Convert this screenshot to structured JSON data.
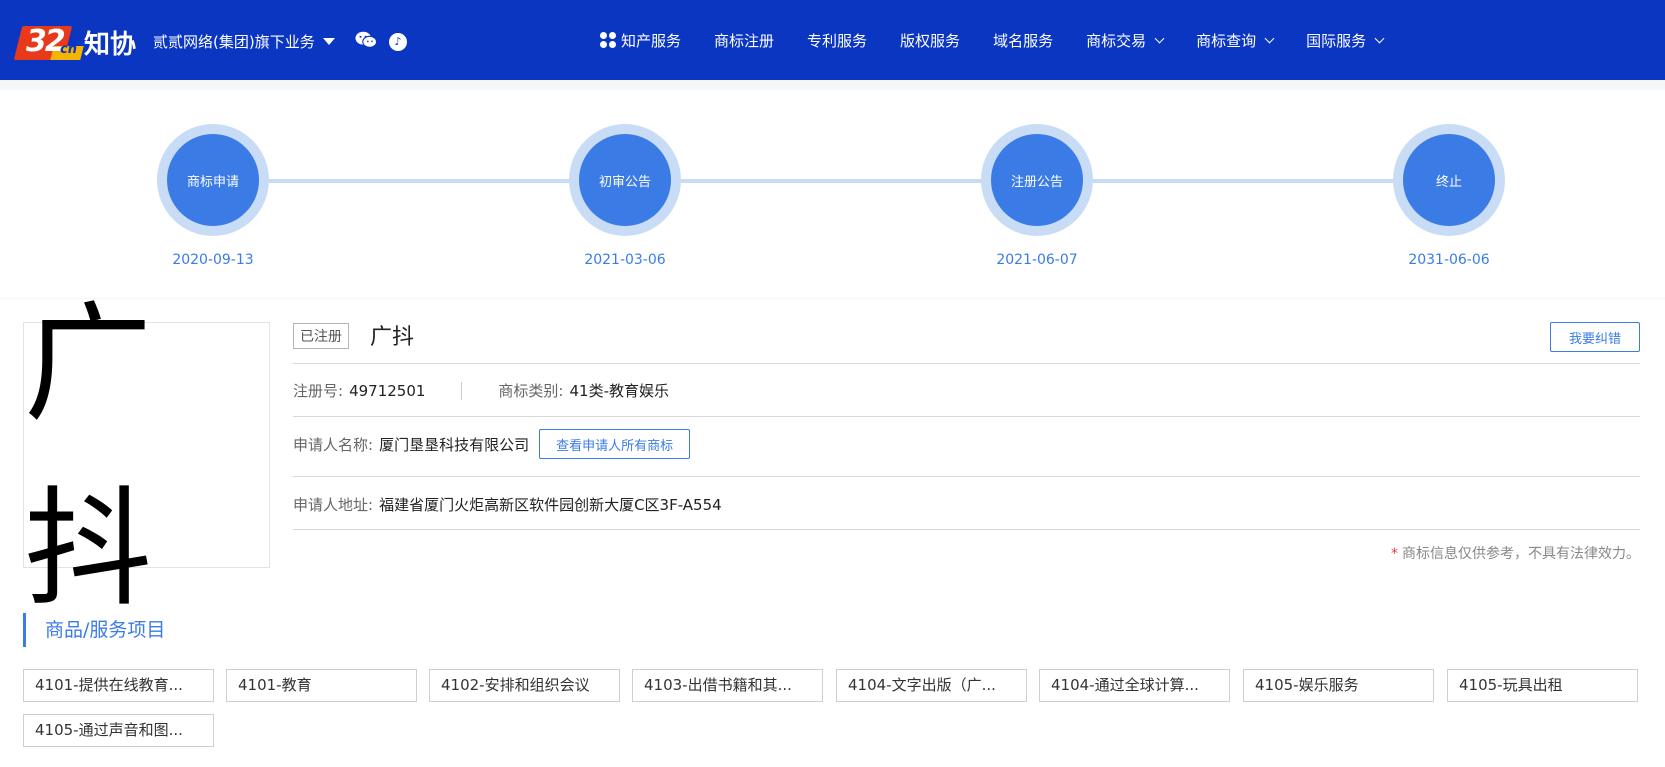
{
  "header": {
    "logo_number": "32",
    "logo_cn": "cn",
    "logo_text": "知协",
    "group_label": "贰贰网络(集团)旗下业务",
    "douyin_glyph": "♪",
    "nav": [
      {
        "label": "知产服务",
        "icon": "clover-icon",
        "dropdown": false
      },
      {
        "label": "商标注册",
        "dropdown": false
      },
      {
        "label": "专利服务",
        "dropdown": false
      },
      {
        "label": "版权服务",
        "dropdown": false
      },
      {
        "label": "域名服务",
        "dropdown": false
      },
      {
        "label": "商标交易",
        "dropdown": true
      },
      {
        "label": "商标查询",
        "dropdown": true
      },
      {
        "label": "国际服务",
        "dropdown": true
      }
    ]
  },
  "timeline": [
    {
      "label": "商标申请",
      "date": "2020-09-13"
    },
    {
      "label": "初审公告",
      "date": "2021-03-06"
    },
    {
      "label": "注册公告",
      "date": "2021-06-07"
    },
    {
      "label": "终止",
      "date": "2031-06-06"
    }
  ],
  "trademark": {
    "image_text": "广抖",
    "status": "已注册",
    "name": "广抖",
    "correct_label": "我要纠错",
    "reg_no_label": "注册号:",
    "reg_no": "49712501",
    "class_label": "商标类别:",
    "class_value": "41类-教育娱乐",
    "applicant_label": "申请人名称:",
    "applicant": "厦门垦垦科技有限公司",
    "view_all_label": "查看申请人所有商标",
    "address_label": "申请人地址:",
    "address": "福建省厦门火炬高新区软件园创新大厦C区3F-A554",
    "note_star": "*",
    "note": "商标信息仅供参考，不具有法律效力。"
  },
  "goods": {
    "title": "商品/服务项目",
    "items": [
      "4101-提供在线教育...",
      "4101-教育",
      "4102-安排和组织会议",
      "4103-出借书籍和其...",
      "4104-文字出版（广...",
      "4104-通过全球计算...",
      "4105-娱乐服务",
      "4105-玩具出租",
      "4105-通过声音和图..."
    ]
  },
  "colors": {
    "header_bg": "#0a36c2",
    "accent": "#3b7be6",
    "ring": "#c9dcf6"
  }
}
